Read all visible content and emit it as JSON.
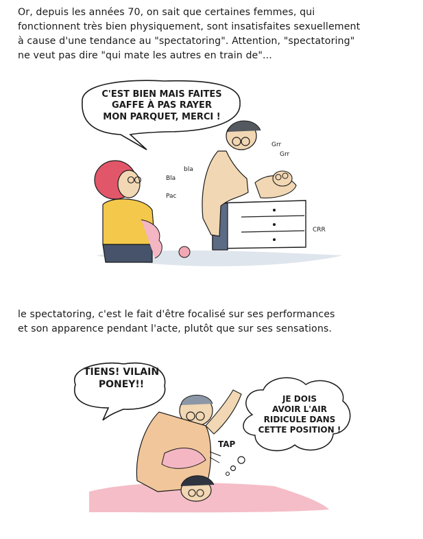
{
  "caption_top": [
    "Or, depuis les années 70, on sait que certaines femmes, qui",
    "fonctionnent très bien physiquement, sont insatisfaites sexuellement",
    "à cause d'une tendance au \"spectatoring\". Attention, \"spectatoring\"",
    "ne veut pas dire \"qui mate les autres en train de\"..."
  ],
  "panel1": {
    "speech": [
      "C'EST BIEN MAIS FAITES",
      "GAFFE À PAS RAYER",
      "MON PARQUET, MERCI !"
    ],
    "sfx_left": [
      "Bla",
      "bla",
      "Pac"
    ],
    "sfx_right": [
      "Grr",
      "Grr"
    ],
    "sfx_crr": "CRR"
  },
  "caption_middle": [
    "le spectatoring, c'est le fait d'être focalisé sur ses performances",
    "et son apparence pendant l'acte, plutôt que sur ses sensations."
  ],
  "panel2": {
    "shout": [
      "TIENS! VILAIN",
      "PONEY!!"
    ],
    "thought": [
      "JE DOIS",
      "AVOIR L'AIR",
      "RIDICULE DANS",
      "CETTE POSITION !"
    ],
    "sfx_tap": "TAP"
  },
  "colors": {
    "ink": "#1a1a1a",
    "skin": "#f1d7b3",
    "hair_red": "#e2566a",
    "shirt_yellow": "#f4c84a",
    "furniture_blue": "#5b6b84",
    "pink_sheet": "#f2a7b4"
  }
}
